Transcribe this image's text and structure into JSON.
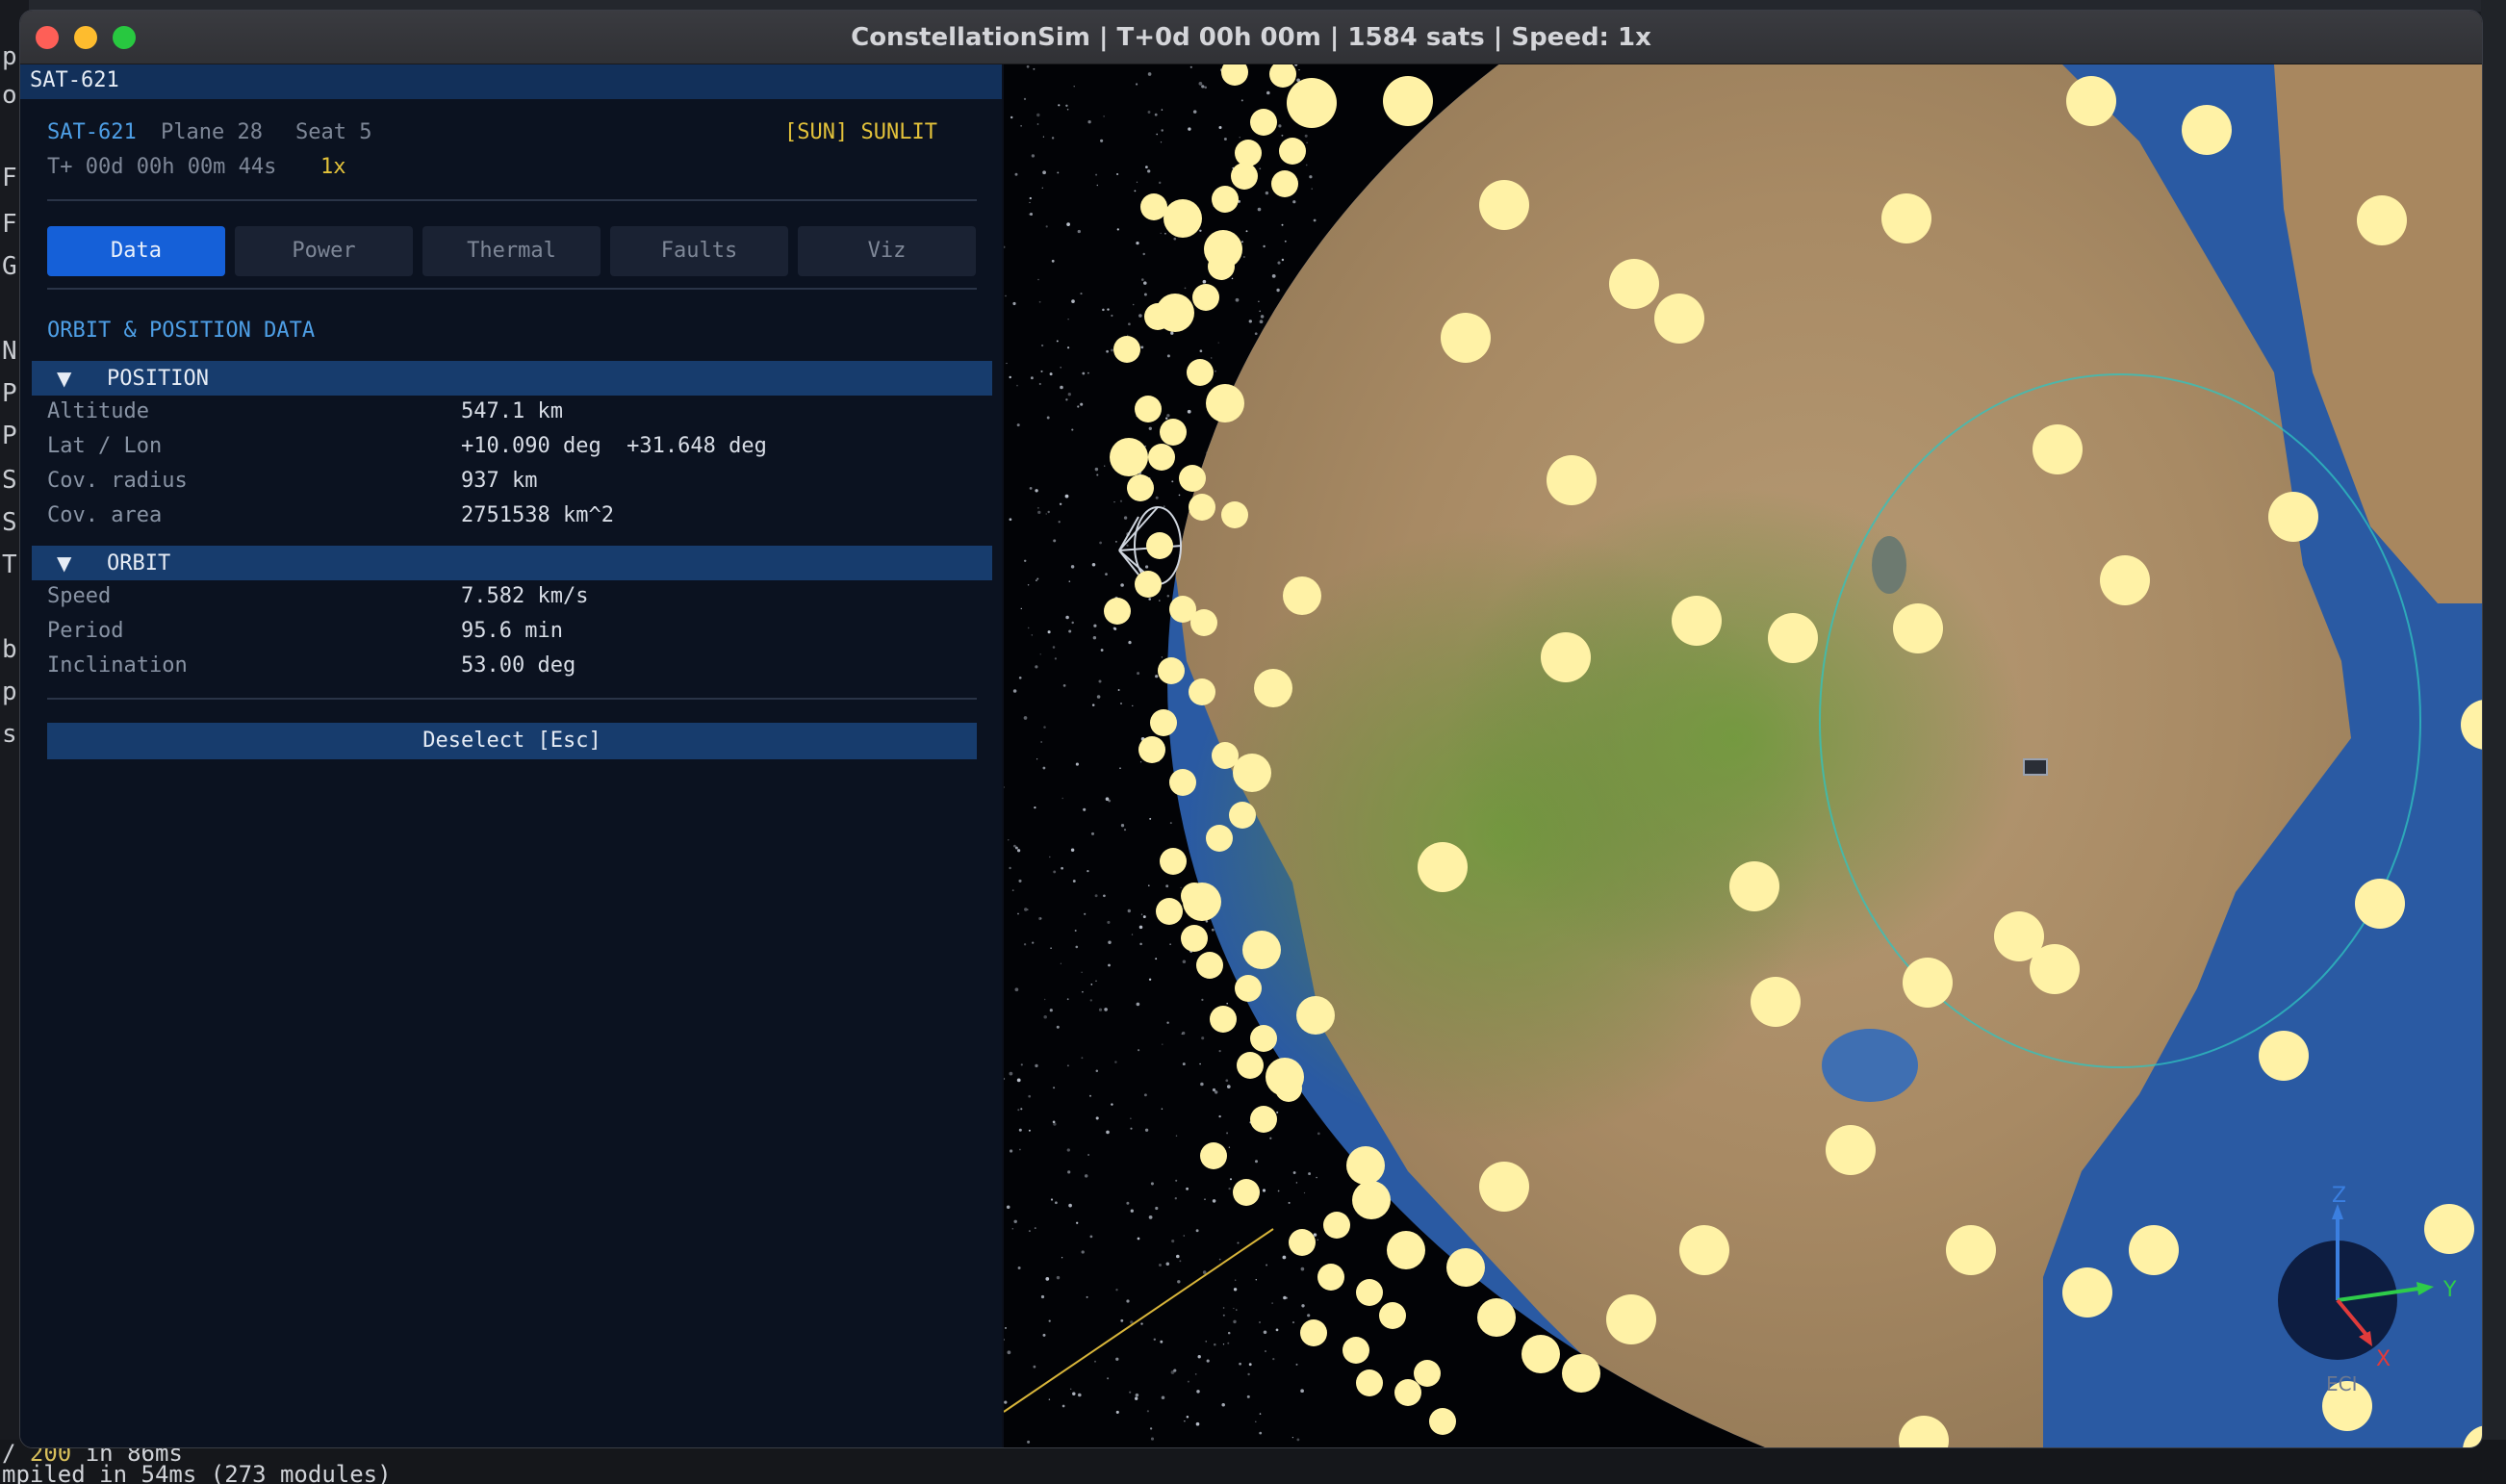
{
  "window": {
    "title": "ConstellationSim | T+0d 00h 00m | 1584 sats | Speed: 1x"
  },
  "background": {
    "terminal_line_1_a": "/ ",
    "terminal_line_1_b": "200",
    "terminal_line_1_c": " in 86ms",
    "terminal_line_2": "mpiled in 54ms (273 modules)"
  },
  "panel": {
    "header": "SAT-621",
    "sat_id": "SAT-621",
    "plane": "Plane 28",
    "seat": "Seat 5",
    "sun_status": "[SUN] SUNLIT",
    "time": "T+ 00d 00h 00m 44s",
    "speed": "1x",
    "tabs": [
      "Data",
      "Power",
      "Thermal",
      "Faults",
      "Viz"
    ],
    "active_tab": "Data",
    "section_title": "ORBIT & POSITION DATA",
    "position": {
      "title": "POSITION",
      "rows": [
        {
          "label": "Altitude",
          "value": "547.1 km"
        },
        {
          "label": "Lat / Lon",
          "value": "+10.090 deg  +31.648 deg"
        },
        {
          "label": "Cov. radius",
          "value": "937 km"
        },
        {
          "label": "Cov. area",
          "value": "2751538 km^2"
        }
      ]
    },
    "orbit": {
      "title": "ORBIT",
      "rows": [
        {
          "label": "Speed",
          "value": "7.582 km/s"
        },
        {
          "label": "Period",
          "value": "95.6 min"
        },
        {
          "label": "Inclination",
          "value": "53.00 deg"
        }
      ]
    },
    "deselect_label": "Deselect  [Esc]"
  },
  "view": {
    "axis_z": "Z",
    "axis_y": "Y",
    "axis_x": "X",
    "frame_label": "ECI"
  },
  "colors": {
    "accent": "#1560d8",
    "satellite": "#fff2a6",
    "coverage_ring": "#2fc4c0",
    "sunlit": "#e3c23a"
  }
}
